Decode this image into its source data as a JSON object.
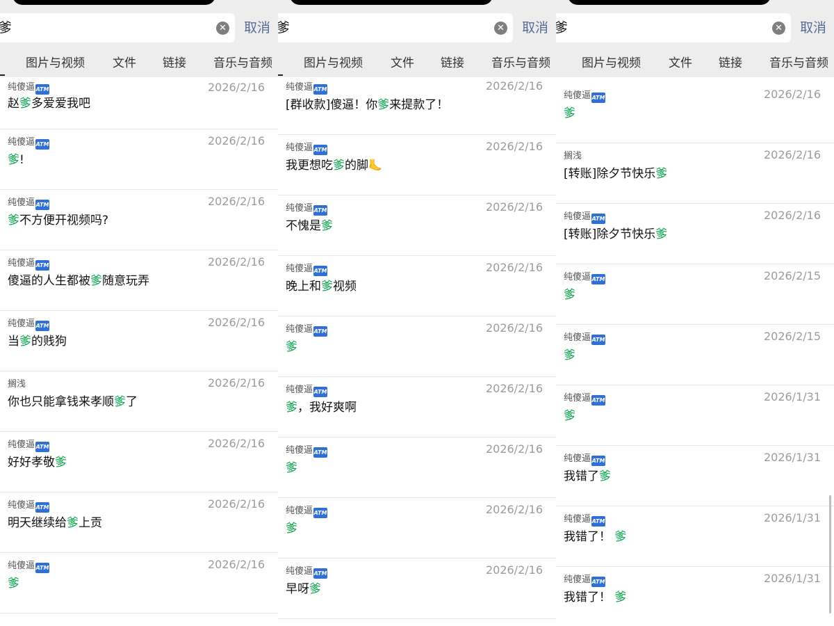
{
  "search": {
    "query": "爹",
    "cancel_label": "取消",
    "tabs": [
      "图片与视频",
      "文件",
      "链接",
      "音乐与音频"
    ]
  },
  "colors": {
    "highlight": "#07a34a",
    "cancel": "#576b95",
    "header_bg": "#ededed",
    "date": "#9b9b9b"
  },
  "badge_text": "ATM",
  "panels": [
    {
      "results": [
        {
          "sender": "纯傻逼",
          "badge": true,
          "date": "2026/2/16",
          "parts": [
            "赵",
            "爹",
            "多爱爱我吧"
          ]
        },
        {
          "sender": "纯傻逼",
          "badge": true,
          "date": "2026/2/16",
          "parts": [
            "",
            "爹",
            "!"
          ]
        },
        {
          "sender": "纯傻逼",
          "badge": true,
          "date": "2026/2/16",
          "parts": [
            "",
            "爹",
            "不方便开视频吗?"
          ]
        },
        {
          "sender": "纯傻逼",
          "badge": true,
          "date": "2026/2/16",
          "parts": [
            "傻逼的人生都被",
            "爹",
            "随意玩弄"
          ]
        },
        {
          "sender": "纯傻逼",
          "badge": true,
          "date": "2026/2/16",
          "parts": [
            "当",
            "爹",
            "的贱狗"
          ]
        },
        {
          "sender": "搁浅",
          "badge": false,
          "date": "2026/2/16",
          "parts": [
            "你也只能拿钱来孝顺",
            "爹",
            "了"
          ]
        },
        {
          "sender": "纯傻逼",
          "badge": true,
          "date": "2026/2/16",
          "parts": [
            "好好孝敬",
            "爹",
            ""
          ]
        },
        {
          "sender": "纯傻逼",
          "badge": true,
          "date": "2026/2/16",
          "parts": [
            "明天继续给",
            "爹",
            "上贡"
          ]
        },
        {
          "sender": "纯傻逼",
          "badge": true,
          "date": "2026/2/16",
          "parts": [
            "",
            "爹",
            ""
          ]
        }
      ]
    },
    {
      "results": [
        {
          "sender": "纯傻逼",
          "badge": true,
          "date": "2026/2/16",
          "parts": [
            "[群收款]傻逼！你",
            "爹",
            "来提款了！"
          ]
        },
        {
          "sender": "纯傻逼",
          "badge": true,
          "date": "2026/2/16",
          "parts": [
            "我更想吃",
            "爹",
            "的脚"
          ],
          "trail_icon": "foot-icon"
        },
        {
          "sender": "纯傻逼",
          "badge": true,
          "date": "2026/2/16",
          "parts": [
            "不愧是",
            "爹",
            ""
          ]
        },
        {
          "sender": "纯傻逼",
          "badge": true,
          "date": "2026/2/16",
          "parts": [
            "晚上和",
            "爹",
            "视频"
          ]
        },
        {
          "sender": "纯傻逼",
          "badge": true,
          "date": "2026/2/16",
          "parts": [
            "",
            "爹",
            ""
          ]
        },
        {
          "sender": "纯傻逼",
          "badge": true,
          "date": "2026/2/16",
          "parts": [
            "",
            "爹",
            "，我好爽啊"
          ]
        },
        {
          "sender": "纯傻逼",
          "badge": true,
          "date": "2026/2/16",
          "parts": [
            "",
            "爹",
            ""
          ]
        },
        {
          "sender": "纯傻逼",
          "badge": true,
          "date": "2026/2/16",
          "parts": [
            "",
            "爹",
            ""
          ]
        },
        {
          "sender": "纯傻逼",
          "badge": true,
          "date": "2026/2/16",
          "parts": [
            "早呀",
            "爹",
            ""
          ]
        }
      ]
    },
    {
      "results": [
        {
          "sender": "纯傻逼",
          "badge": true,
          "date": "2026/2/16",
          "parts": [
            "",
            "爹",
            ""
          ]
        },
        {
          "sender": "搁浅",
          "badge": false,
          "date": "2026/2/16",
          "parts": [
            "[转账]除夕节快乐",
            "爹",
            ""
          ]
        },
        {
          "sender": "纯傻逼",
          "badge": true,
          "date": "2026/2/16",
          "parts": [
            "[转账]除夕节快乐",
            "爹",
            ""
          ]
        },
        {
          "sender": "纯傻逼",
          "badge": true,
          "date": "2026/2/15",
          "parts": [
            "",
            "爹",
            ""
          ]
        },
        {
          "sender": "纯傻逼",
          "badge": true,
          "date": "2026/2/15",
          "parts": [
            "",
            "爹",
            ""
          ]
        },
        {
          "sender": "纯傻逼",
          "badge": true,
          "date": "2026/1/31",
          "parts": [
            "",
            "爹",
            ""
          ]
        },
        {
          "sender": "纯傻逼",
          "badge": true,
          "date": "2026/1/31",
          "parts": [
            "我错了",
            "爹",
            ""
          ]
        },
        {
          "sender": "纯傻逼",
          "badge": true,
          "date": "2026/1/31",
          "parts": [
            "我错了！ ",
            "爹",
            ""
          ]
        },
        {
          "sender": "纯傻逼",
          "badge": true,
          "date": "2026/1/31",
          "parts": [
            "我错了！ ",
            "爹",
            ""
          ]
        }
      ]
    }
  ]
}
